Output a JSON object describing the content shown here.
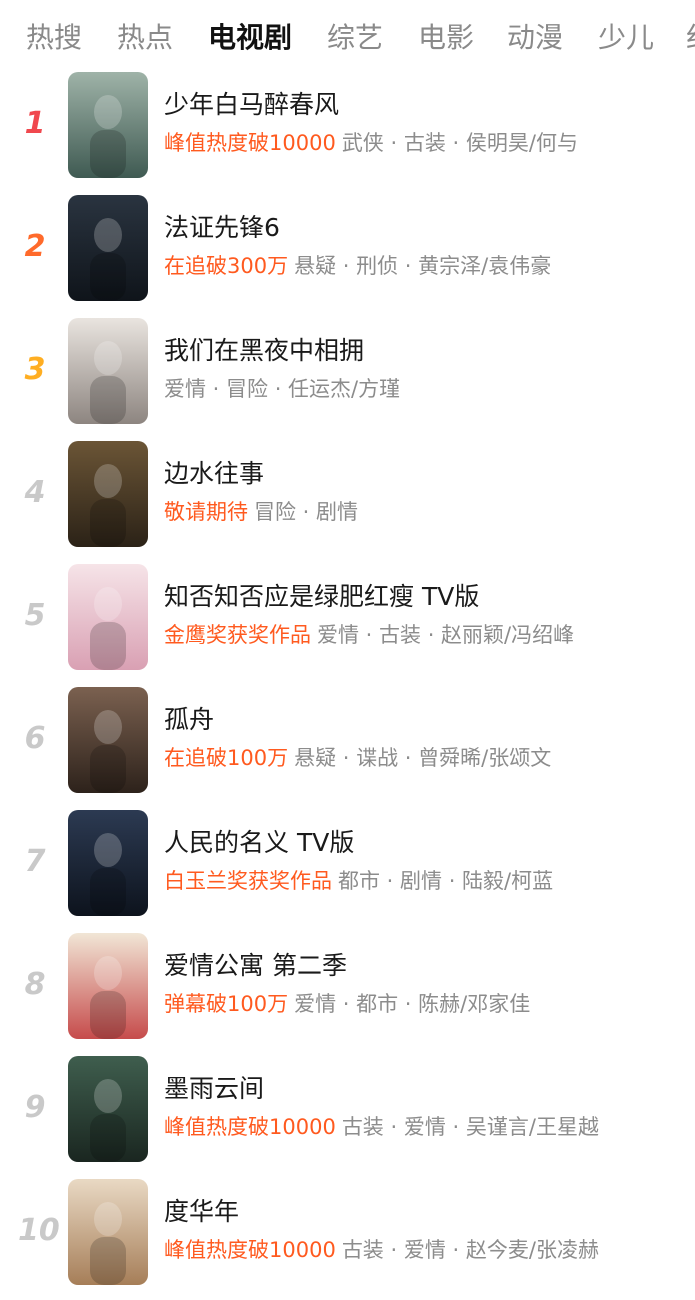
{
  "tabs": [
    {
      "label": "热搜",
      "active": false
    },
    {
      "label": "热点",
      "active": false
    },
    {
      "label": "电视剧",
      "active": true
    },
    {
      "label": "综艺",
      "active": false
    },
    {
      "label": "电影",
      "active": false
    },
    {
      "label": "动漫",
      "active": false
    },
    {
      "label": "少儿",
      "active": false
    },
    {
      "label": "纪",
      "active": false
    }
  ],
  "items": [
    {
      "rank": "1",
      "title": "少年白马醉春风",
      "highlight": "峰值热度破10000",
      "meta": "武侠 · 古装 · 侯明昊/何与",
      "poster_colors": [
        "#9fb3a8",
        "#3f5a52"
      ]
    },
    {
      "rank": "2",
      "title": "法证先锋6",
      "highlight": "在追破300万",
      "meta": "悬疑 · 刑侦 · 黄宗泽/袁伟豪",
      "poster_colors": [
        "#2a3440",
        "#0f141a"
      ]
    },
    {
      "rank": "3",
      "title": "我们在黑夜中相拥",
      "highlight": "",
      "meta": "爱情 · 冒险 · 任运杰/方瑾",
      "poster_colors": [
        "#e9e4df",
        "#8d8580"
      ]
    },
    {
      "rank": "4",
      "title": "边水往事",
      "highlight": "敬请期待",
      "meta": "冒险 · 剧情",
      "poster_colors": [
        "#6b5536",
        "#2b2217"
      ]
    },
    {
      "rank": "5",
      "title": "知否知否应是绿肥红瘦 TV版",
      "highlight": "金鹰奖获奖作品",
      "meta": "爱情 · 古装 · 赵丽颖/冯绍峰",
      "poster_colors": [
        "#f6e4e8",
        "#d9a0b3"
      ]
    },
    {
      "rank": "6",
      "title": "孤舟",
      "highlight": "在追破100万",
      "meta": "悬疑 · 谍战 · 曾舜晞/张颂文",
      "poster_colors": [
        "#7b6150",
        "#2d221b"
      ]
    },
    {
      "rank": "7",
      "title": "人民的名义 TV版",
      "highlight": "白玉兰奖获奖作品",
      "meta": "都市 · 剧情 · 陆毅/柯蓝",
      "poster_colors": [
        "#2c3a52",
        "#0d131d"
      ]
    },
    {
      "rank": "8",
      "title": "爱情公寓 第二季",
      "highlight": "弹幕破100万",
      "meta": "爱情 · 都市 · 陈赫/邓家佳",
      "poster_colors": [
        "#f1e6d6",
        "#c64b4b"
      ]
    },
    {
      "rank": "9",
      "title": "墨雨云间",
      "highlight": "峰值热度破10000",
      "meta": "古装 · 爱情 · 吴谨言/王星越",
      "poster_colors": [
        "#3f5e4e",
        "#1a2620"
      ]
    },
    {
      "rank": "10",
      "title": "度华年",
      "highlight": "峰值热度破10000",
      "meta": "古装 · 爱情 · 赵今麦/张凌赫",
      "poster_colors": [
        "#e9d9c4",
        "#a67e58"
      ]
    }
  ]
}
